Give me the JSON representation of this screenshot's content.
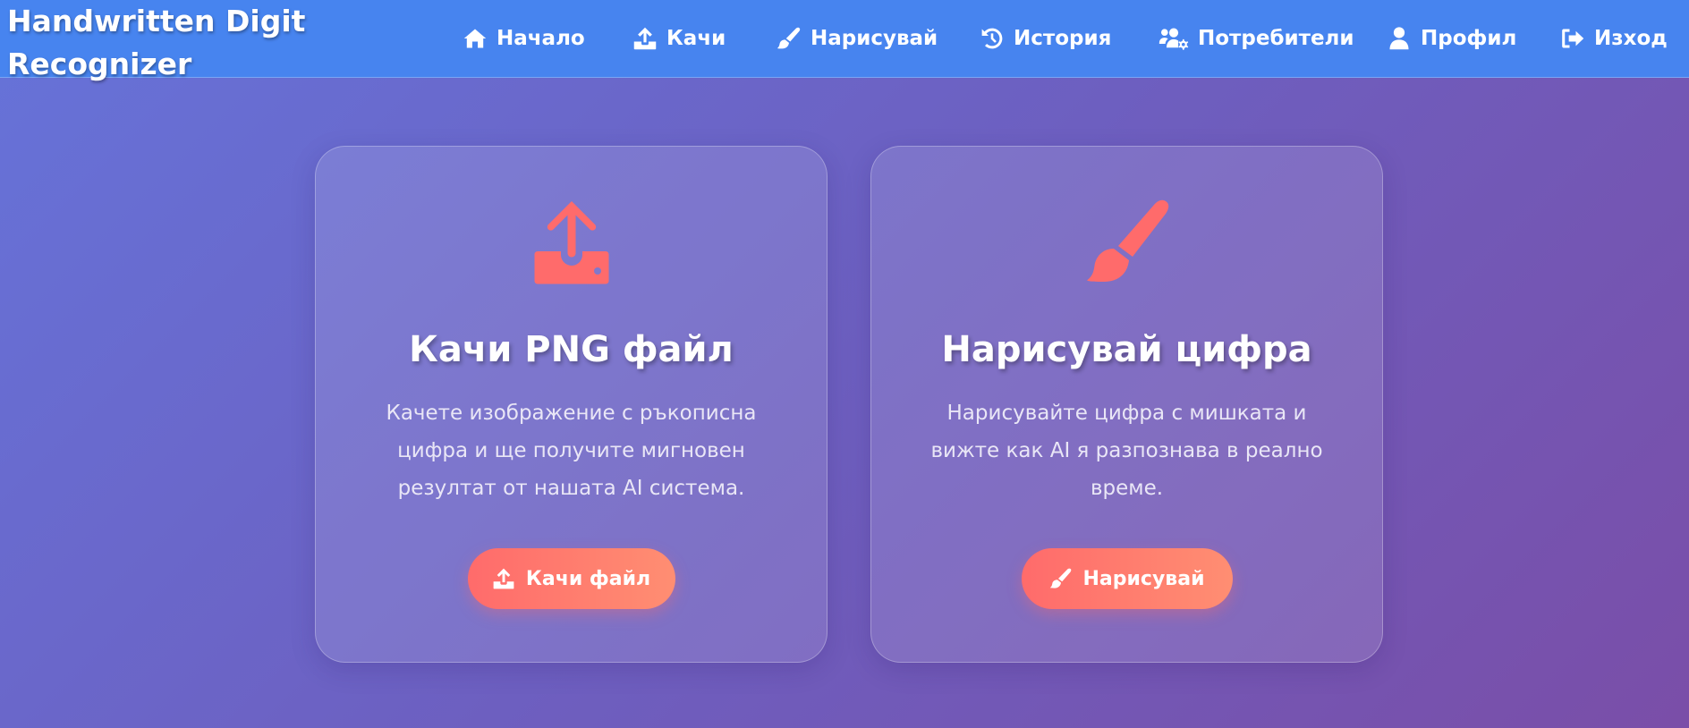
{
  "brand": {
    "title": "Handwritten Digit Recognizer"
  },
  "nav": {
    "home": "Начало",
    "upload": "Качи",
    "draw": "Нарисувай",
    "history": "История",
    "users": "Потребители",
    "profile": "Профил",
    "logout": "Изход"
  },
  "cards": [
    {
      "icon": "upload-icon",
      "title": "Качи PNG файл",
      "text": "Качете изображение с ръкописна цифра и ще получите мигновен резултат от нашата AI система.",
      "button": "Качи файл"
    },
    {
      "icon": "paintbrush-icon",
      "title": "Нарисувай цифра",
      "text": "Нарисувайте цифра с мишката и вижте как AI я разпознава в реално време.",
      "button": "Нарисувай"
    }
  ],
  "colors": {
    "navbar": "#4784ef",
    "accent": "#ff6b6b",
    "background_start": "#6673d9",
    "background_end": "#7a4ea8"
  }
}
